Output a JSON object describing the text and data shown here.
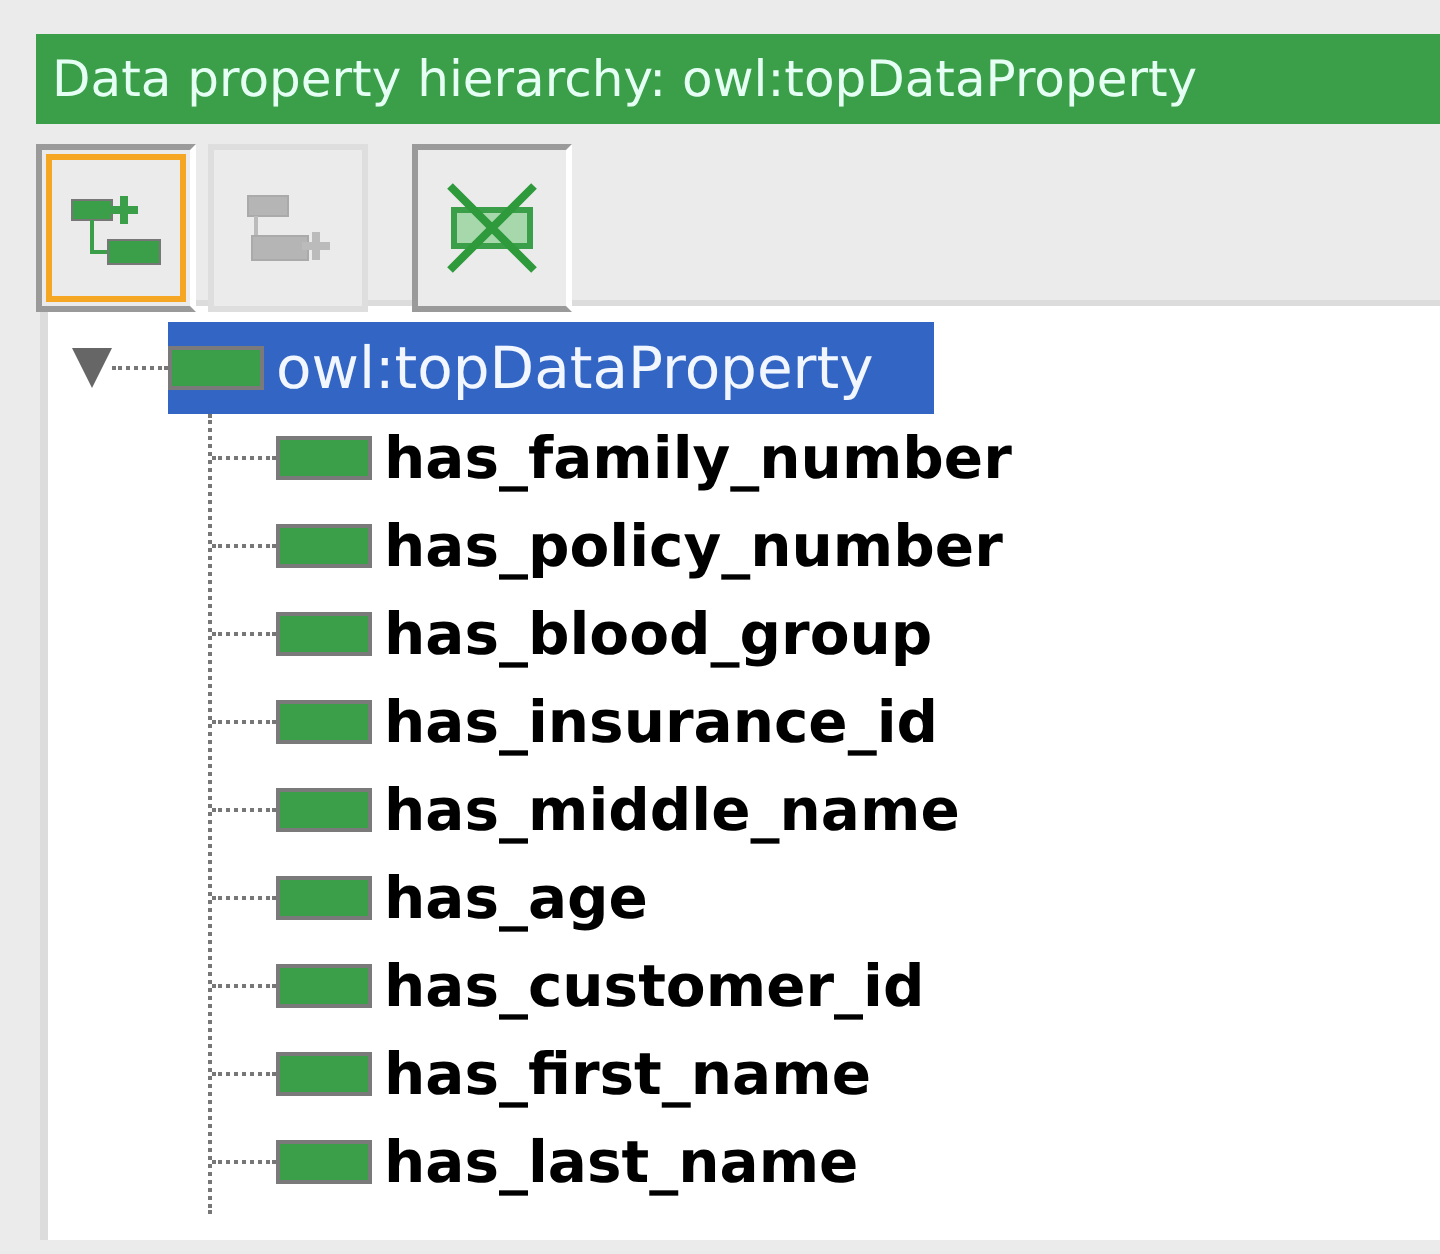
{
  "panel": {
    "title": "Data property hierarchy: owl:topDataProperty"
  },
  "toolbar": [
    {
      "kind": "add-sub",
      "selected": true,
      "disabled": false
    },
    {
      "kind": "add-sibling",
      "selected": false,
      "disabled": true
    },
    {
      "kind": "delete",
      "selected": false,
      "disabled": false
    }
  ],
  "tree": {
    "label": "owl:topDataProperty",
    "selected": true,
    "expanded": true,
    "children": [
      {
        "label": "has_family_number"
      },
      {
        "label": "has_policy_number"
      },
      {
        "label": "has_blood_group"
      },
      {
        "label": "has_insurance_id"
      },
      {
        "label": "has_middle_name"
      },
      {
        "label": "has_age"
      },
      {
        "label": "has_customer_id"
      },
      {
        "label": "has_first_name"
      },
      {
        "label": "has_last_name"
      }
    ]
  }
}
